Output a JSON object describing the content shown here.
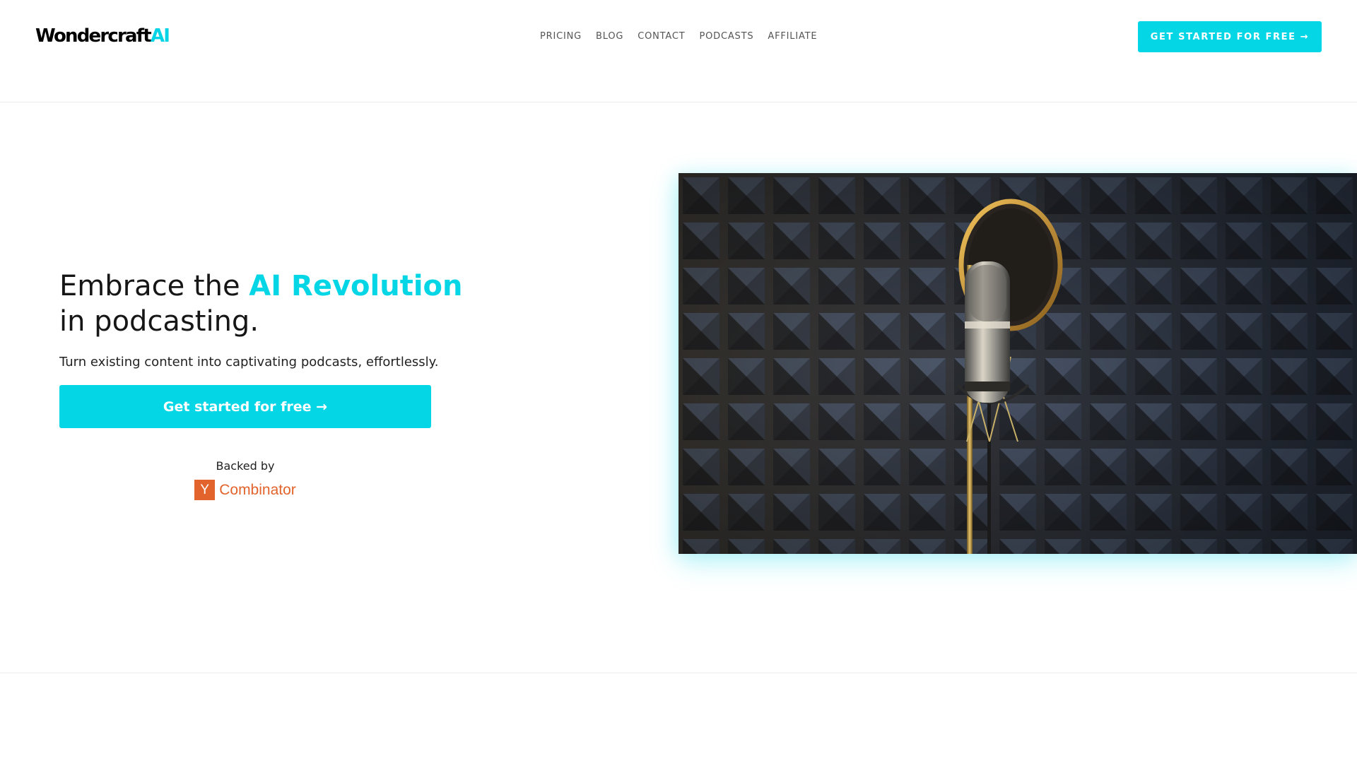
{
  "brand": {
    "name": "Wondercraft",
    "suffix": "AI"
  },
  "nav": {
    "items": [
      "PRICING",
      "BLOG",
      "CONTACT",
      "PODCASTS",
      "AFFILIATE"
    ]
  },
  "header_cta": {
    "label": "GET STARTED FOR FREE →"
  },
  "hero": {
    "headline_part1": "Embrace the ",
    "headline_accent": "AI Revolution",
    "headline_part2": "in podcasting.",
    "subhead": "Turn existing content into captivating podcasts, effortlessly.",
    "cta_label": "Get started for free →",
    "backed_by": "Backed by",
    "backer": {
      "mark": "Y",
      "name": "Combinator"
    }
  },
  "colors": {
    "accent": "#05d6e6",
    "yc_orange": "#e2632b"
  },
  "icons": {
    "yc_logo": "y-combinator-logo",
    "hero_image": "studio-microphone-photo"
  }
}
